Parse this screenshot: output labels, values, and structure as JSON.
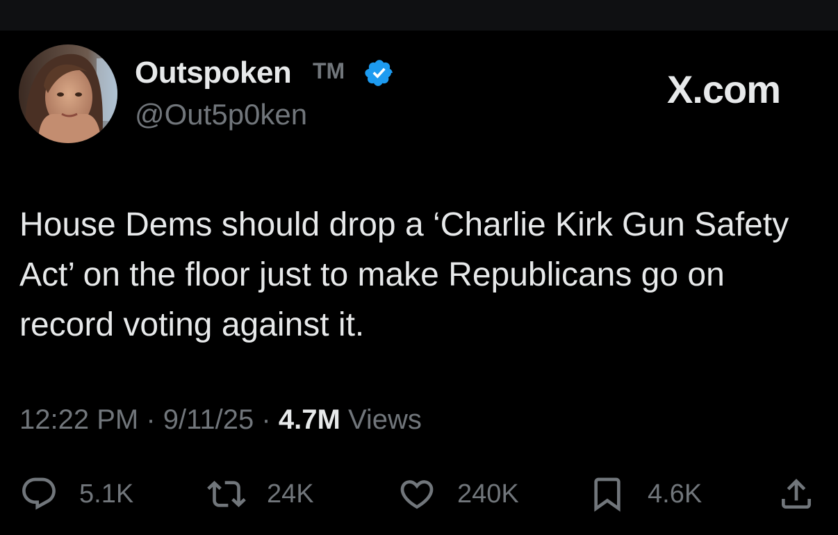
{
  "author": {
    "display_name": "Outspoken",
    "tm": "TM",
    "handle": "@Out5p0ken",
    "verified": true
  },
  "site_logo": "X.com",
  "tweet": {
    "text": "House Dems should drop a ‘Charlie Kirk Gun Safety Act’ on the floor just to make Republicans go on record voting against it."
  },
  "meta": {
    "time": "12:22 PM",
    "separator1": "·",
    "date": "9/11/25",
    "separator2": "·",
    "views_count": "4.7M",
    "views_label": "Views"
  },
  "actions": {
    "replies": "5.1K",
    "reposts": "24K",
    "likes": "240K",
    "bookmarks": "4.6K"
  },
  "icons": {
    "verified": "verified-badge-icon",
    "reply": "reply-icon",
    "repost": "repost-icon",
    "like": "heart-icon",
    "bookmark": "bookmark-icon",
    "share": "share-icon"
  },
  "colors": {
    "background": "#000000",
    "text_primary": "#e7e9ea",
    "text_secondary": "#71767b",
    "verified_blue": "#1d9bf0"
  }
}
